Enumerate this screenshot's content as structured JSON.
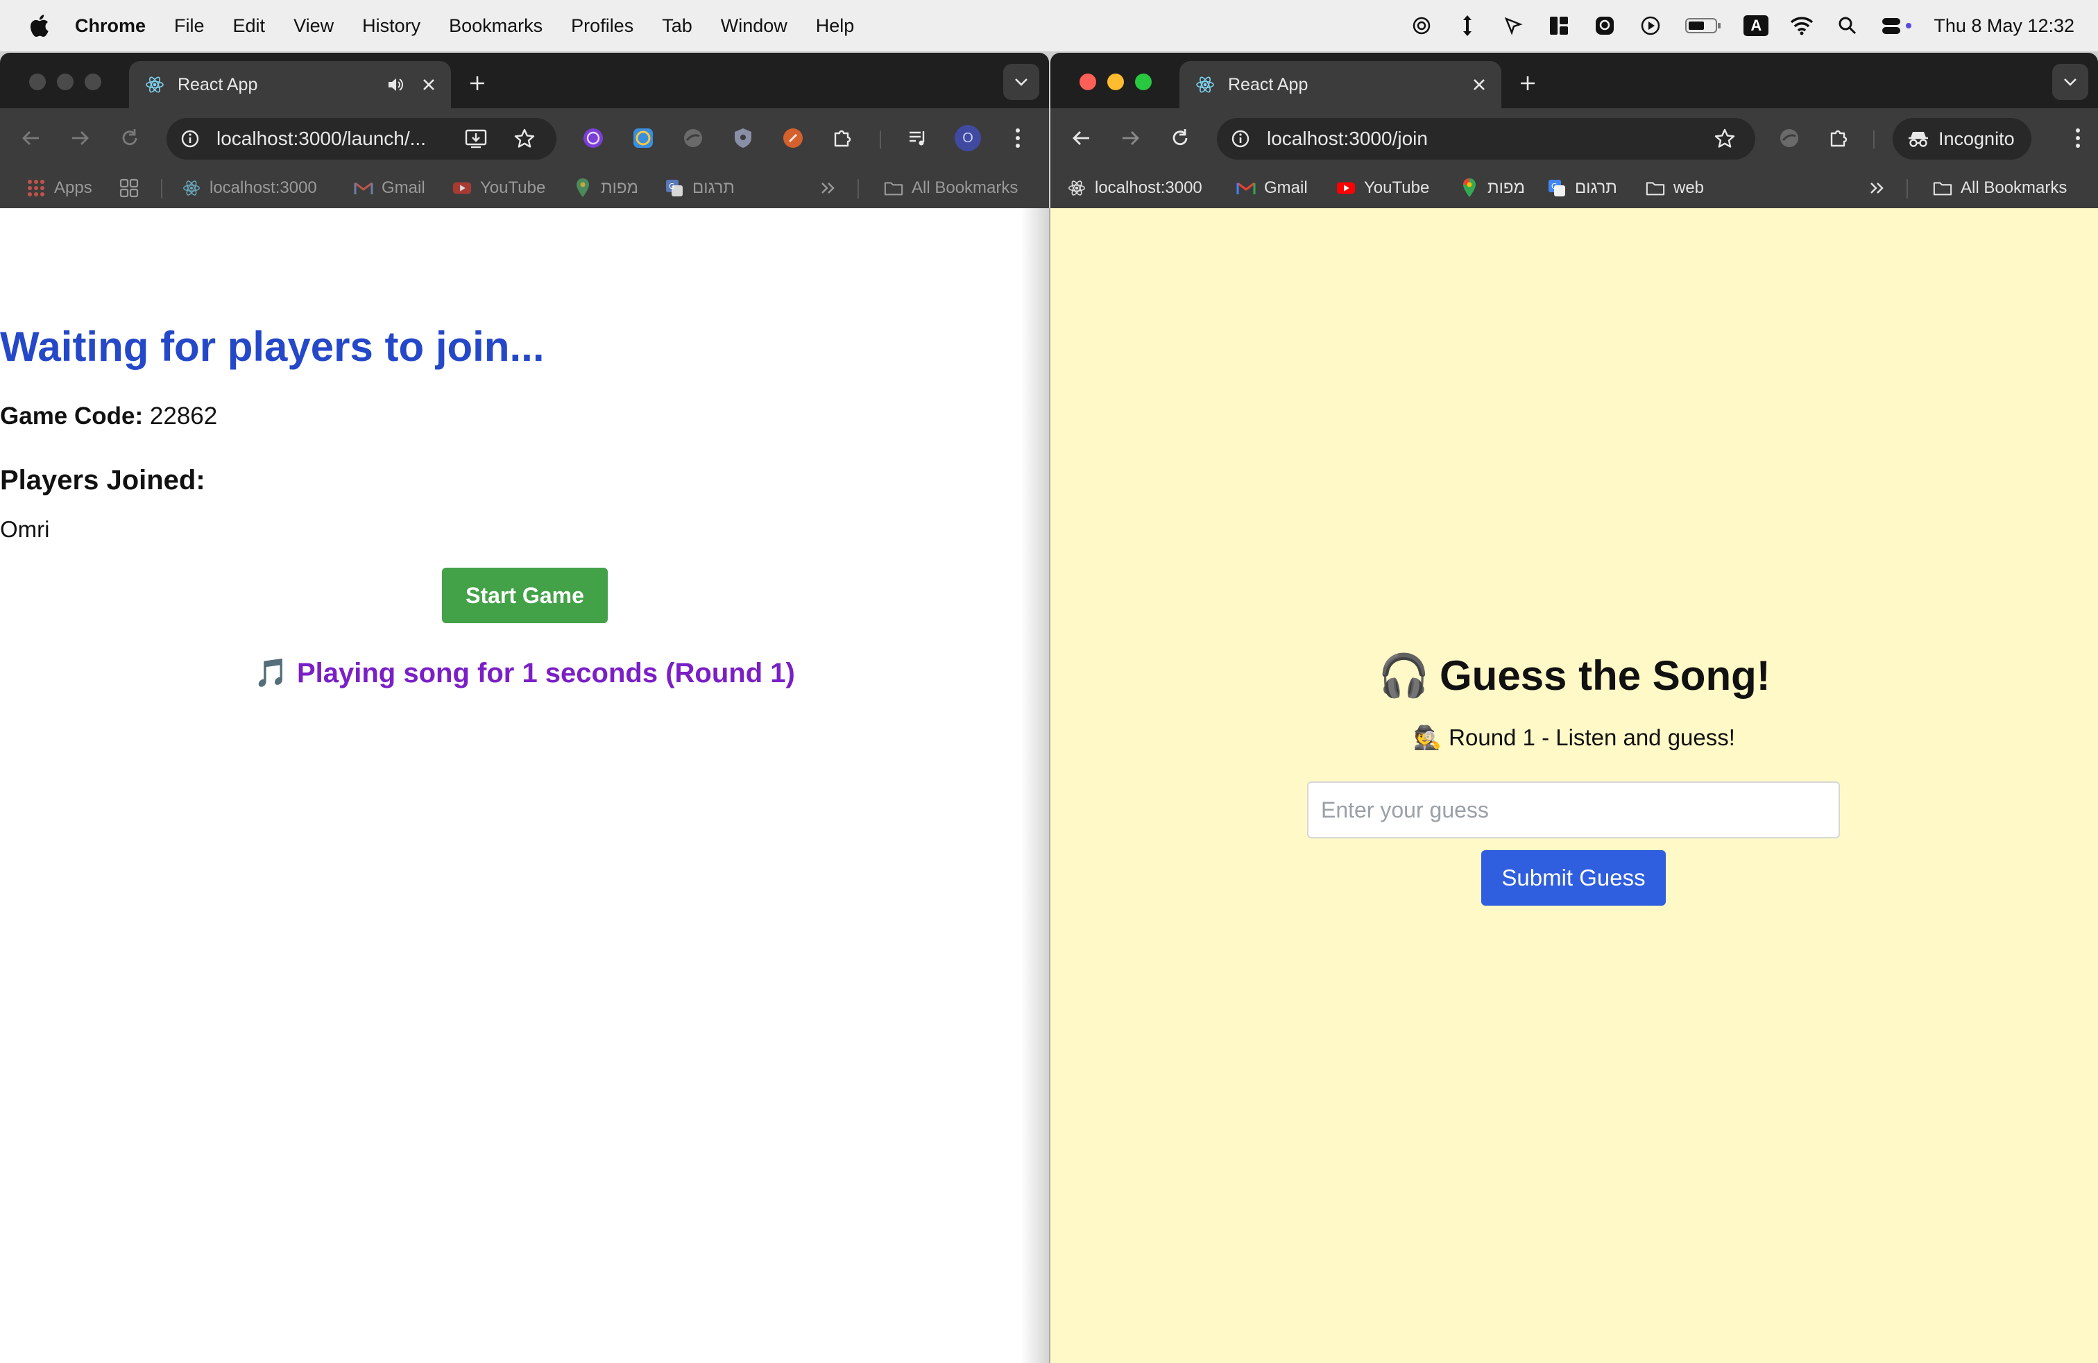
{
  "menubar": {
    "app_name": "Chrome",
    "items": [
      "File",
      "Edit",
      "View",
      "History",
      "Bookmarks",
      "Profiles",
      "Tab",
      "Window",
      "Help"
    ],
    "clock": "Thu 8 May  12:32",
    "input_source": "A"
  },
  "left_window": {
    "tab_title": "React App",
    "url": "localhost:3000/launch/...",
    "profile_initial": "O",
    "bookmarks": {
      "apps": "Apps",
      "localhost": "localhost:3000",
      "gmail": "Gmail",
      "youtube": "YouTube",
      "maps": "מפות",
      "translate": "תרגום",
      "all": "All Bookmarks"
    },
    "page": {
      "title": "Waiting for players to join...",
      "game_code_label": "Game Code:",
      "game_code": "22862",
      "players_heading": "Players Joined:",
      "players": [
        "Omri"
      ],
      "start_button": "Start Game",
      "playing_icon": "🎵",
      "playing_text": "Playing song for 1 seconds (Round 1)"
    }
  },
  "right_window": {
    "tab_title": "React App",
    "url": "localhost:3000/join",
    "incognito_label": "Incognito",
    "bookmarks": {
      "localhost": "localhost:3000",
      "gmail": "Gmail",
      "youtube": "YouTube",
      "maps": "מפות",
      "translate": "תרגום",
      "web": "web",
      "all": "All Bookmarks"
    },
    "page": {
      "title_icon": "🎧",
      "title": "Guess the Song!",
      "round_icon": "🕵",
      "round_text": "Round 1 - Listen and guess!",
      "guess_placeholder": "Enter your guess",
      "submit_button": "Submit Guess"
    },
    "background_color": "#fef9c6"
  },
  "colors": {
    "lobby_title": "#2548c8",
    "start_button": "#43a148",
    "playing_text": "#7a1fc6",
    "submit_button": "#2f5ede"
  }
}
